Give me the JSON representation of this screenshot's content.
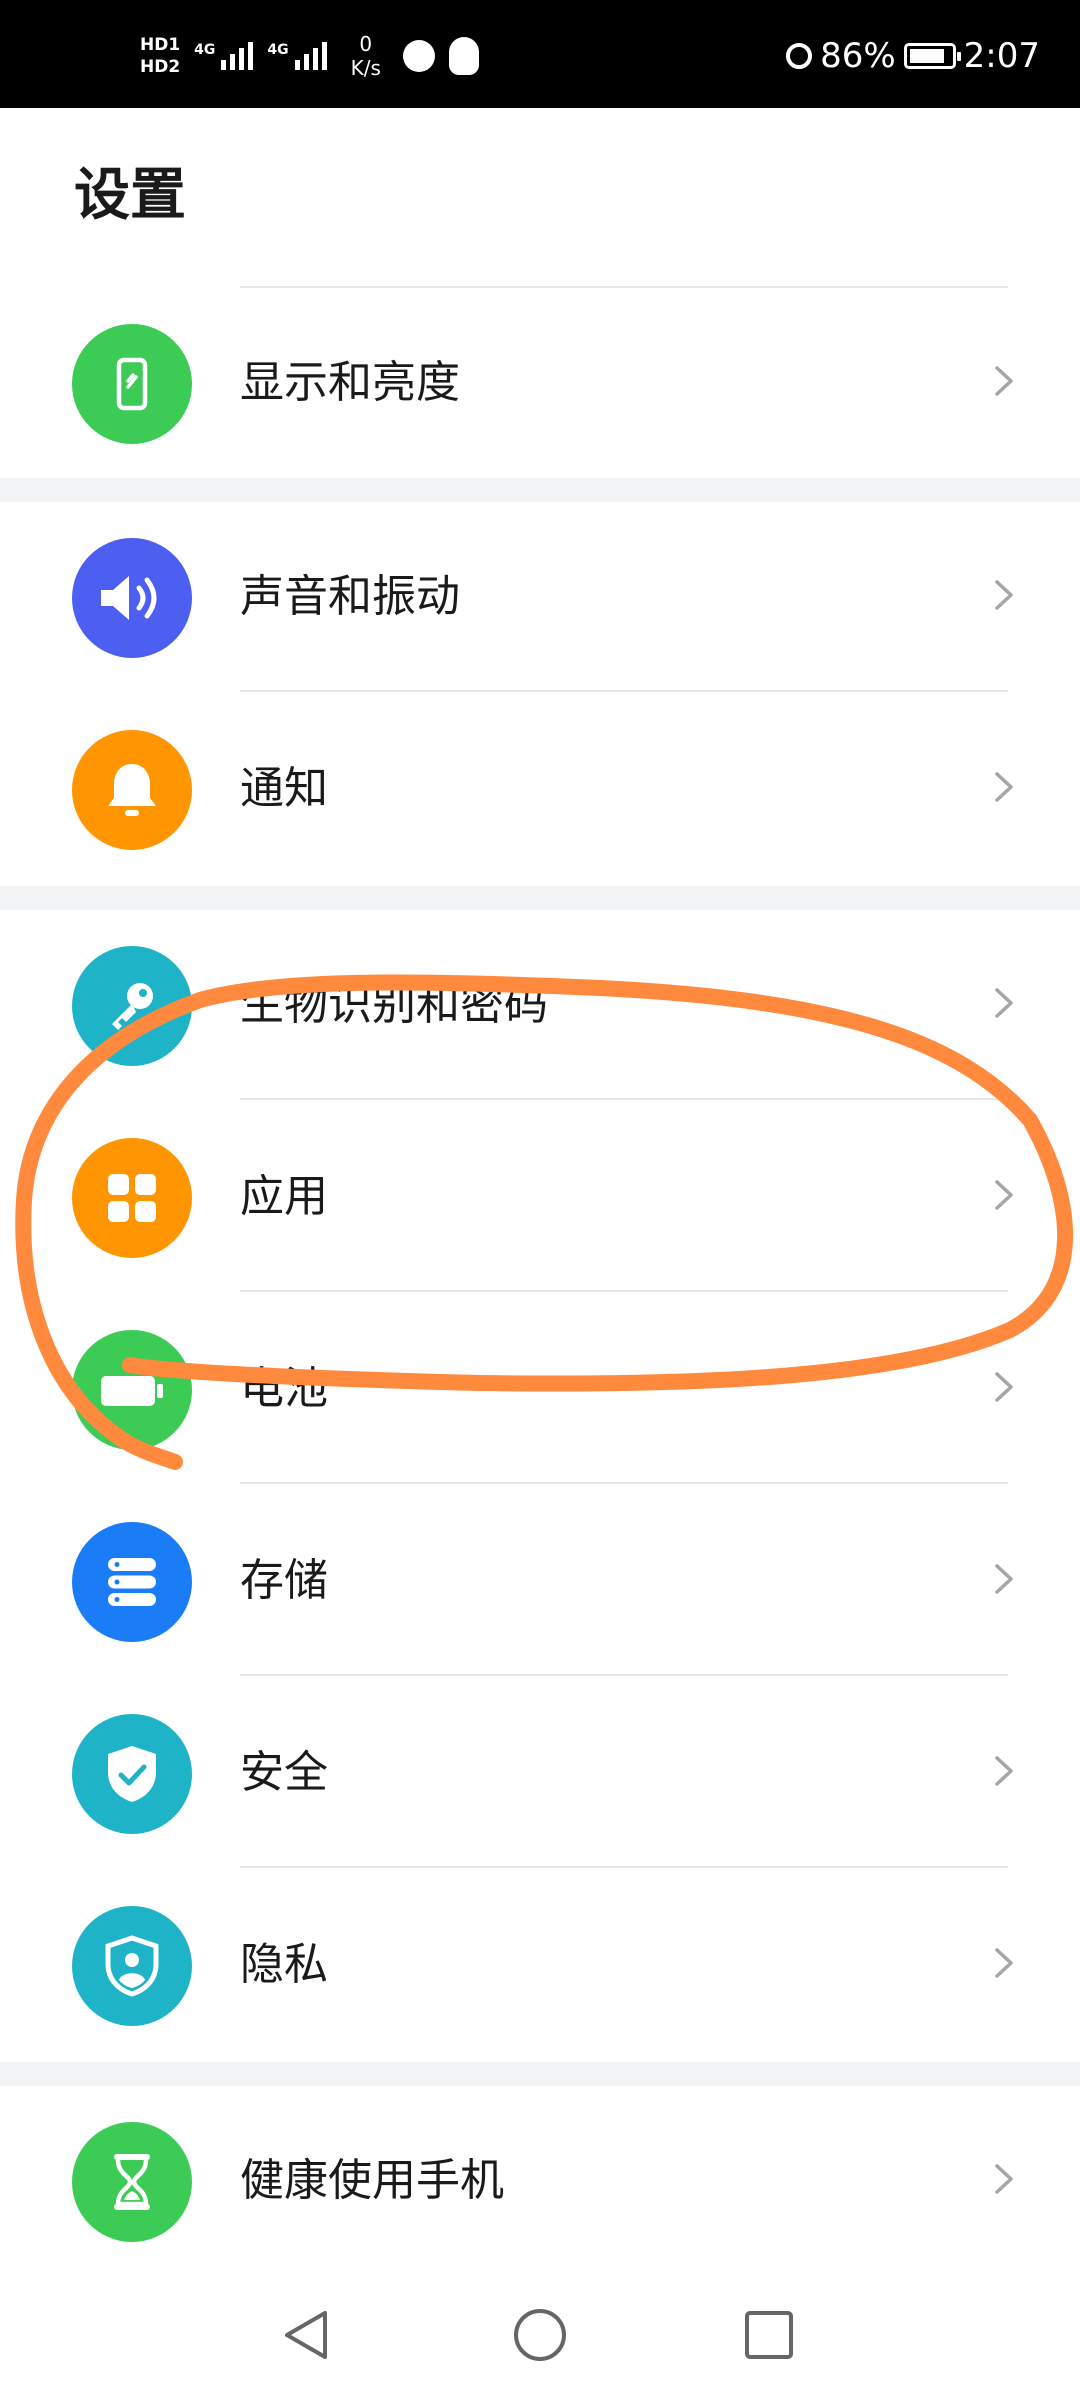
{
  "status_bar": {
    "hd1": "HD1",
    "hd2": "HD2",
    "sig1": "4G",
    "sig2": "4G",
    "speed_value": "0",
    "speed_unit": "K/s",
    "battery_percent": "86%",
    "battery_level": 0.86,
    "time": "2:07"
  },
  "page": {
    "title": "设置"
  },
  "items": [
    {
      "label": "显示和亮度",
      "icon": "display-brightness-icon",
      "color": "#3ccc56"
    },
    {
      "label": "声音和振动",
      "icon": "speaker-icon",
      "color": "#4d5ff0"
    },
    {
      "label": "通知",
      "icon": "bell-icon",
      "color": "#ff9500"
    },
    {
      "label": "生物识别和密码",
      "icon": "key-icon",
      "color": "#1fb3c8"
    },
    {
      "label": "应用",
      "icon": "apps-grid-icon",
      "color": "#ff9500"
    },
    {
      "label": "电池",
      "icon": "battery-icon",
      "color": "#3ccc56"
    },
    {
      "label": "存储",
      "icon": "storage-icon",
      "color": "#1a7df7"
    },
    {
      "label": "安全",
      "icon": "shield-check-icon",
      "color": "#1fb3c8"
    },
    {
      "label": "隐私",
      "icon": "privacy-shield-icon",
      "color": "#1fb3c8"
    },
    {
      "label": "健康使用手机",
      "icon": "hourglass-icon",
      "color": "#3ccc56"
    }
  ],
  "annotation": {
    "color": "#ff8a3d",
    "target_item": "应用"
  }
}
